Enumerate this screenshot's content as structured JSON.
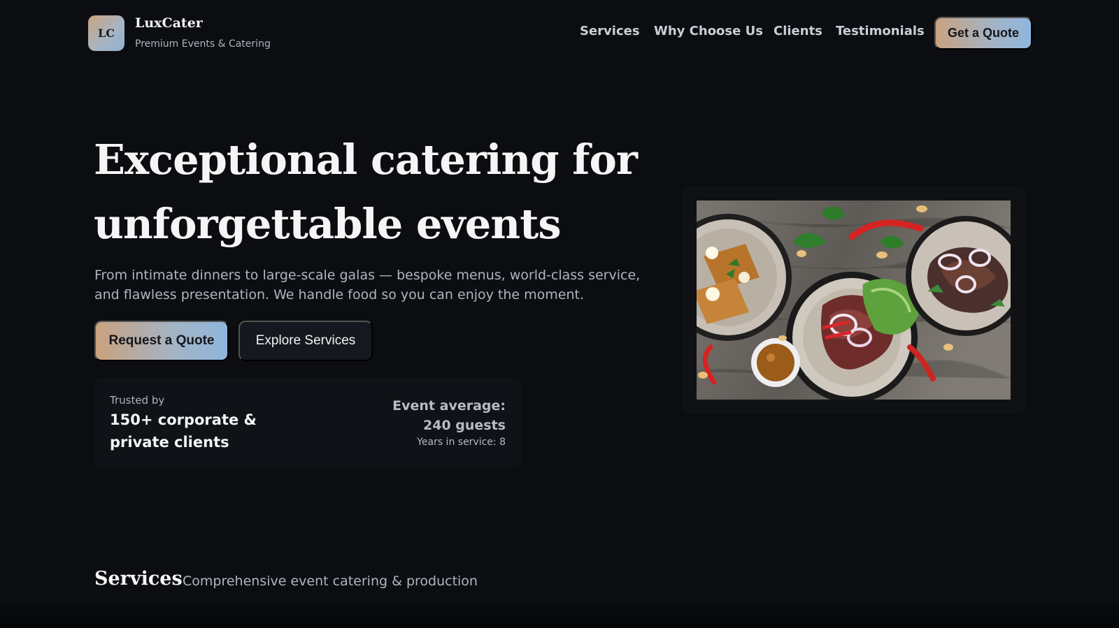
{
  "brand": {
    "logo_initials": "LC",
    "name": "LuxCater",
    "tagline": "Premium Events & Catering"
  },
  "nav": {
    "items": [
      "Services",
      "Why Choose Us",
      "Clients",
      "Testimonials"
    ],
    "cta_label": "Get a Quote"
  },
  "hero": {
    "title": "Exceptional catering for unforgettable events",
    "subtitle": "From intimate dinners to large-scale galas — bespoke menus, world-class service, and flawless presentation. We handle food so you can enjoy the moment.",
    "primary_button": "Request a Quote",
    "secondary_button": "Explore Services",
    "stats": {
      "trusted_label": "Trusted by",
      "trusted_value": "150+ corporate & private clients",
      "event_average": "Event average: 240 guests",
      "years_in_service": "Years in service: 8"
    },
    "image": {
      "description": "food-platter-image"
    }
  },
  "services": {
    "title": "Services",
    "subtitle": "Comprehensive event catering & production"
  },
  "colors": {
    "background": "#0b0d11",
    "accent_gradient_start": "#c9a27e",
    "accent_gradient_end": "#8fb6dd"
  }
}
